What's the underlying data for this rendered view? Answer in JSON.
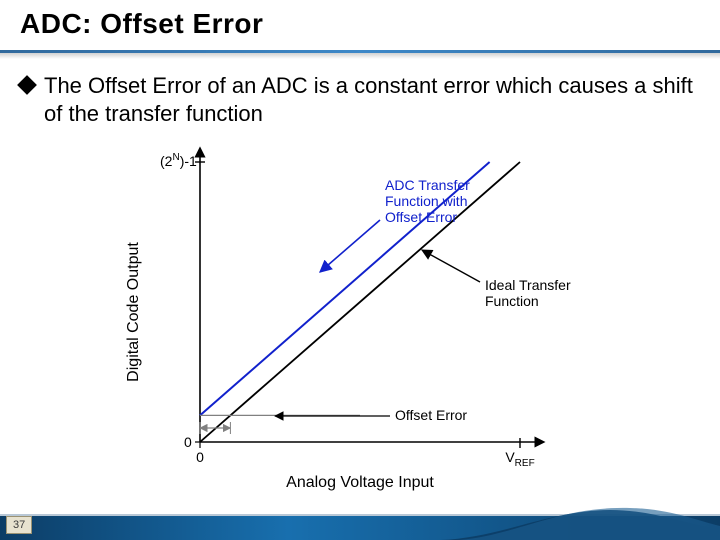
{
  "slide": {
    "title": "ADC: Offset Error",
    "bullet_text": "The Offset Error of an ADC is a constant error which causes a shift of the transfer function",
    "page_number": "37"
  },
  "figure": {
    "y_axis_label": "Digital Code Output",
    "x_axis_label": "Analog Voltage Input",
    "y_top_tick_pre": "(2",
    "y_top_tick_exp": "N",
    "y_top_tick_post": ")-1",
    "y_bottom_tick": "0",
    "x_left_tick": "0",
    "x_right_tick_pre": "V",
    "x_right_tick_sub": "REF",
    "annotation_offset_curve_l1": "ADC Transfer",
    "annotation_offset_curve_l2": "Function with",
    "annotation_offset_curve_l3": "Offset Error",
    "annotation_ideal_l1": "Ideal Transfer",
    "annotation_ideal_l2": "Function",
    "annotation_offset_error": "Offset Error",
    "colors": {
      "ideal_line": "#000000",
      "offset_line": "#1121cc",
      "annotation_text_blue": "#1121cc",
      "axis": "#000000",
      "offset_guide": "#808080"
    },
    "chart_data": {
      "type": "line",
      "x_range": [
        0,
        1
      ],
      "y_range": [
        0,
        1
      ],
      "x_units": "fraction of VREF",
      "y_units": "fraction of full-scale code ((2^N)-1)",
      "series": [
        {
          "name": "Ideal Transfer Function",
          "points": [
            [
              0,
              0
            ],
            [
              1,
              1
            ]
          ]
        },
        {
          "name": "ADC Transfer Function with Offset Error",
          "points": [
            [
              0,
              0.095
            ],
            [
              0.905,
              1
            ]
          ]
        }
      ],
      "offset_error_fraction_of_fullscale": 0.095
    }
  }
}
